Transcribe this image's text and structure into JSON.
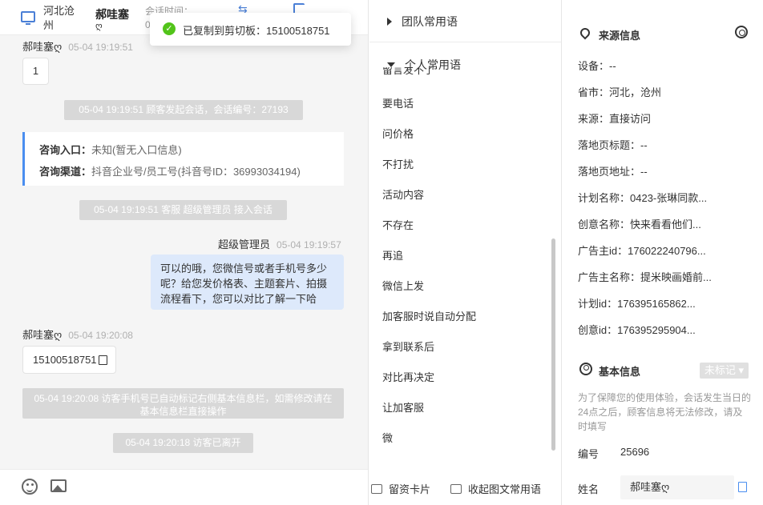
{
  "chat": {
    "header": {
      "region": "河北沧州",
      "visitor_name": "郝哇塞",
      "visitor_name_sub": "ღ",
      "session_time_label": "会话时间：",
      "session_time_value": "0"
    },
    "toast": "已复制到剪切板：15100518751",
    "messages": [
      {
        "sender": "郝哇塞ღ",
        "time": "05-04 19:19:51",
        "content": "1"
      },
      {
        "system": "05-04 19:19:51 顾客发起会话，会话编号：27193"
      },
      {
        "system": "05-04 19:19:51 客服 超级管理员 接入会话"
      },
      {
        "sender": "超级管理员",
        "time": "05-04 19:19:57",
        "content": "可以的哦，您微信号或者手机号多少呢？给您发价格表、主题套片、拍摄流程看下，您可以对比了解一下哈"
      },
      {
        "sender": "郝哇塞ღ",
        "time": "05-04 19:20:08",
        "content": "15100518751"
      },
      {
        "system": "05-04 19:20:08 访客手机号已自动标记右侧基本信息栏，如需修改请在基本信息栏直接操作"
      },
      {
        "system": "05-04 19:20:18 访客已离开"
      }
    ],
    "info_card": {
      "entry_label": "咨询入口：",
      "entry_value": "未知(暂无入口信息)",
      "channel_label": "咨询渠道：",
      "channel_value": "抖音企业号/员工号(抖音号ID：36993034194)"
    }
  },
  "phrases": {
    "team_group": "团队常用语",
    "personal_group": "个人常用语",
    "partial_item": "留言发不了",
    "items": [
      "要电话",
      "问价格",
      "不打扰",
      "活动内容",
      "不存在",
      "再追",
      "微信上发",
      "加客服时说自动分配",
      "拿到联系后",
      "对比再决定",
      "让加客服",
      "微"
    ],
    "footer": {
      "card": "留资卡片",
      "collapse": "收起图文常用语"
    }
  },
  "info": {
    "source_title": "来源信息",
    "source_fields": [
      "设备：--",
      "省市：河北，沧州",
      "来源：直接访问",
      "落地页标题：--",
      "落地页地址：--",
      "计划名称：0423-张琳同款...",
      "创意名称：快来看看他们...",
      "广告主id：176022240796...",
      "广告主名称：提米映画婚前...",
      "计划id：176395165862...",
      "创意id：176395295904..."
    ],
    "basic_title": "基本信息",
    "tag_label": "未标记 ▾",
    "notice": "为了保障您的使用体验，会话发生当日的24点之后，顾客信息将无法修改，请及时填写",
    "id_label": "编号",
    "id_value": "25696",
    "name_label": "姓名",
    "name_value": "郝哇塞ღ"
  },
  "colors": {
    "accent": "#4a8ef0",
    "success": "#52c41a",
    "agent_bubble": "#dde9fb",
    "system_pill": "#d8d8d8"
  }
}
